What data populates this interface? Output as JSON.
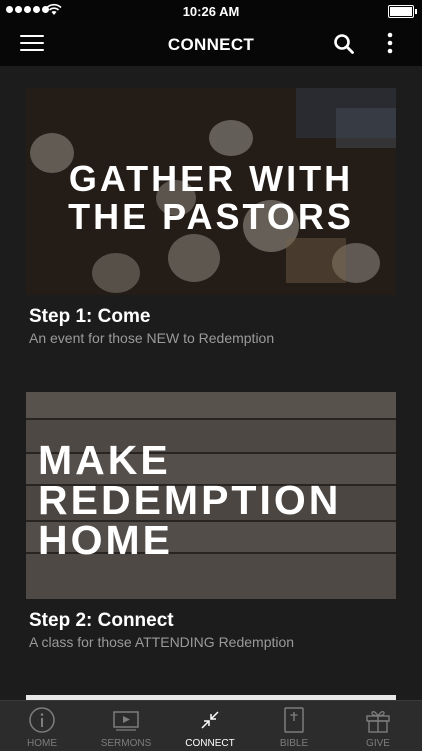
{
  "status_bar": {
    "time": "10:26 AM"
  },
  "header": {
    "title": "CONNECT"
  },
  "cards": [
    {
      "banner_lines": [
        "GATHER WITH",
        "THE PASTORS"
      ],
      "title": "Step 1: Come",
      "subtitle": "An event for those NEW to Redemption"
    },
    {
      "banner_lines": [
        "MAKE",
        "REDEMPTION",
        "HOME"
      ],
      "title": "Step 2: Connect",
      "subtitle": "A class for those ATTENDING Redemption"
    }
  ],
  "tabs": [
    {
      "label": "HOME",
      "icon": "info-circle-icon"
    },
    {
      "label": "SERMONS",
      "icon": "video-play-icon"
    },
    {
      "label": "CONNECT",
      "icon": "collapse-arrows-icon",
      "active": true
    },
    {
      "label": "BIBLE",
      "icon": "bible-book-icon"
    },
    {
      "label": "GIVE",
      "icon": "gift-icon"
    }
  ]
}
